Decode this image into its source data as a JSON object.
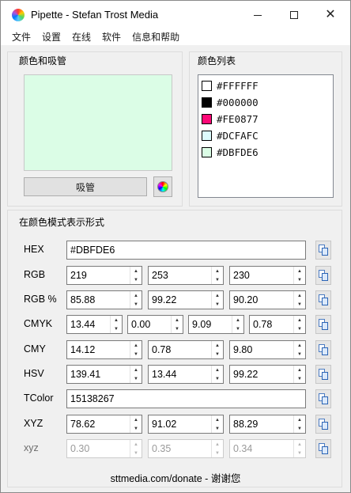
{
  "window": {
    "title": "Pipette - Stefan Trost Media"
  },
  "menu": [
    "文件",
    "设置",
    "在线",
    "软件",
    "信息和帮助"
  ],
  "color_panel": {
    "title": "颜色和吸管",
    "preview_color": "#DBFDE6",
    "pick_button": "吸管",
    "wheel_icon": "color-wheel-icon"
  },
  "color_list": {
    "title": "颜色列表",
    "items": [
      {
        "label": "#FFFFFF",
        "color": "#FFFFFF"
      },
      {
        "label": "#000000",
        "color": "#000000"
      },
      {
        "label": "#FE0877",
        "color": "#FE0877"
      },
      {
        "label": "#DCFAFC",
        "color": "#DCFAFC"
      },
      {
        "label": "#DBFDE6",
        "color": "#DBFDE6"
      }
    ]
  },
  "models": {
    "title": "在颜色模式表示形式",
    "hex": {
      "label": "HEX",
      "value": "#DBFDE6"
    },
    "rgb": {
      "label": "RGB",
      "values": [
        "219",
        "253",
        "230"
      ]
    },
    "rgb_pct": {
      "label": "RGB %",
      "values": [
        "85.88",
        "99.22",
        "90.20"
      ]
    },
    "cmyk": {
      "label": "CMYK",
      "values": [
        "13.44",
        "0.00",
        "9.09",
        "0.78"
      ]
    },
    "cmy": {
      "label": "CMY",
      "values": [
        "14.12",
        "0.78",
        "9.80"
      ]
    },
    "hsv": {
      "label": "HSV",
      "values": [
        "139.41",
        "13.44",
        "99.22"
      ]
    },
    "tcolor": {
      "label": "TColor",
      "value": "15138267"
    },
    "xyz": {
      "label": "XYZ",
      "values": [
        "78.62",
        "91.02",
        "88.29"
      ]
    },
    "xyz_small": {
      "label": "xyz",
      "values": [
        "0.30",
        "0.35",
        "0.34"
      ]
    }
  },
  "footer": {
    "text": "sttmedia.com/donate - 谢谢您"
  },
  "icons": {
    "copy": "copy-icon",
    "spin_up": "▲",
    "spin_down": "▼",
    "close": "✕"
  }
}
